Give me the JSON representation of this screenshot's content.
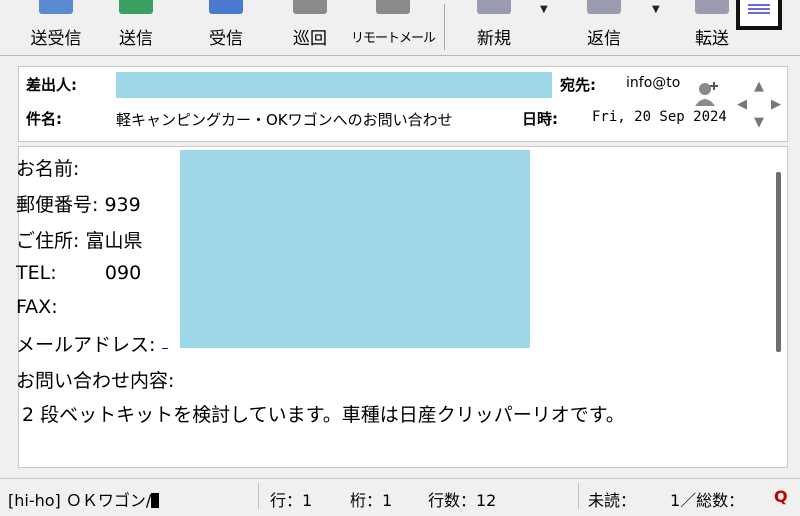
{
  "toolbar": {
    "buttons": [
      {
        "label": "送受信",
        "icon_color": "#5a8ad0"
      },
      {
        "label": "送信",
        "icon_color": "#3aa060"
      },
      {
        "label": "受信",
        "icon_color": "#4a7ad0"
      },
      {
        "label": "巡回",
        "icon_color": "#8a8a8a"
      },
      {
        "label": "リモートメール",
        "icon_color": "#8a8a8a"
      },
      {
        "label": "新規",
        "icon_color": "#9a9ab0"
      },
      {
        "label": "返信",
        "icon_color": "#9a9ab0"
      },
      {
        "label": "転送",
        "icon_color": "#9a9ab0"
      }
    ]
  },
  "header": {
    "from_label": "差出人:",
    "from_value": "",
    "to_label": "宛先:",
    "to_value": "info@to",
    "subject_label": "件名:",
    "subject_value": "軽キャンピングカー・OKワゴンへのお問い合わせ",
    "date_label": "日時:",
    "date_value": "Fri, 20 Sep 2024"
  },
  "body": {
    "lines": [
      "お名前:",
      "郵便番号: 939",
      "ご住所: 富山県",
      "TEL:        090",
      "FAX:",
      "メールアドレス:",
      "お問い合わせ内容:",
      " 2 段ベットキットを検討しています。車種は日産クリッパーリオです。"
    ],
    "redact_color": "#9ed8e8"
  },
  "status": {
    "folder": "[hi-ho] ＯＫワゴン/",
    "row": "行：1",
    "col": "桁：1",
    "line_count": "行数：12",
    "unread": "未読：",
    "total": "1／総数：",
    "q_icon": "Q"
  }
}
